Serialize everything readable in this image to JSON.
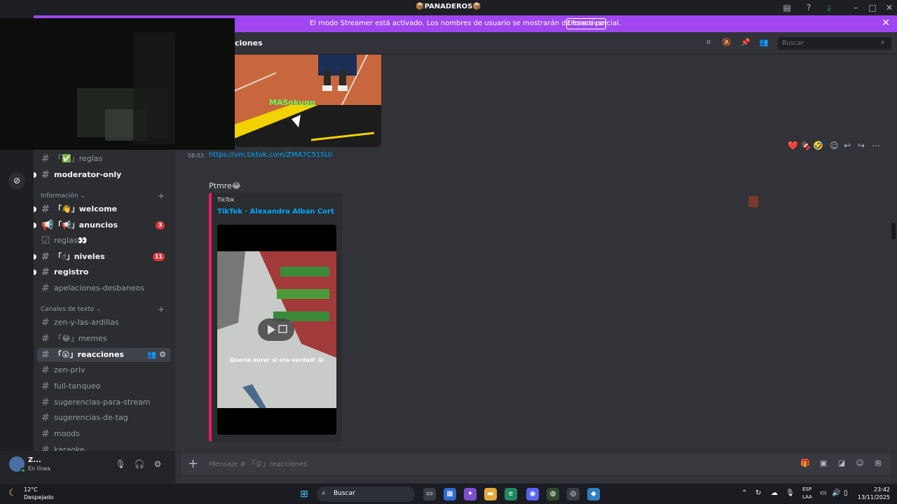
{
  "window": {
    "title": "📦PANADEROS📦"
  },
  "banner": {
    "text": "El modo Streamer está activado. Los nombres de usuario se mostrarán de forma parcial.",
    "button": "Desactivar"
  },
  "header": {
    "channel": "reacciones",
    "channel_visible": "ciones",
    "search_placeholder": "Buscar"
  },
  "sidebar": {
    "channels_top": [
      {
        "label": "「✅」reglas",
        "state": "normal"
      },
      {
        "label": "moderator-only",
        "state": "unread"
      }
    ],
    "categories": [
      {
        "label": "Información ⌄"
      },
      {
        "label": "Canales de texto ⌄"
      }
    ],
    "info_channels": [
      {
        "label": "「👋」welcome",
        "state": "unread"
      },
      {
        "label": "「📢」anuncios",
        "state": "unread",
        "badge": "3"
      },
      {
        "label": "reglas👀",
        "state": "normal"
      },
      {
        "label": "「☝」niveles",
        "state": "unread",
        "badge": "11"
      },
      {
        "label": "registro",
        "state": "unread"
      },
      {
        "label": "apelaciones-desbaneos",
        "state": "normal"
      }
    ],
    "text_channels": [
      {
        "label": "zen-y-las-ardillas"
      },
      {
        "label": "「😂」memes"
      },
      {
        "label": "「😮」reacciones",
        "selected": true
      },
      {
        "label": "zen-priv"
      },
      {
        "label": "full-tanqueo"
      },
      {
        "label": "sugerencias-para-stream"
      },
      {
        "label": "sugerencias-de-tag"
      },
      {
        "label": "moods"
      },
      {
        "label": "karaoke"
      }
    ]
  },
  "chat": {
    "image_caption": "MASokugg",
    "message1": {
      "time": "08:03",
      "link": "https://vm.tiktok.com/ZMA7C51SU/"
    },
    "message2": {
      "text": "Ptmre😂",
      "embed": {
        "provider": "TikTok",
        "title": "TikTok · Alexandra Alban Cort",
        "video_caption": "Queria mirar si era verdad! 😱"
      }
    },
    "reactions": [
      "❤️",
      "🍫",
      "🤣"
    ]
  },
  "composer": {
    "placeholder": "Mensaje # 「😮」reacciones"
  },
  "user": {
    "name": "Z...",
    "status": "En línea"
  },
  "taskbar": {
    "weather_temp": "12°C",
    "weather_desc": "Despejado",
    "search": "Buscar",
    "lang1": "ESP",
    "lang2": "LAA",
    "time": "23:42",
    "date": "13/11/2025"
  }
}
